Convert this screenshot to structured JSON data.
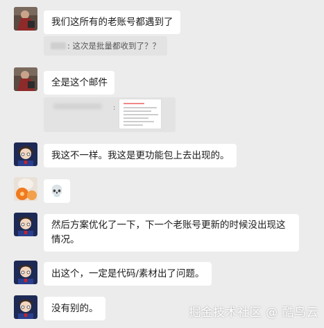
{
  "messages": [
    {
      "avatar": "user-avatar-dark-red",
      "text": "我们这所有的老账号都遇到了"
    },
    {
      "quote": ": 这次是批量都收到了？？"
    },
    {
      "avatar": "user-avatar-dark-red",
      "text": "全是这个邮件"
    },
    {
      "quote_image_sep": ":"
    },
    {
      "avatar": "user-avatar-anime-blue",
      "text": "我这不一样。我这是更功能包上去出现的。"
    },
    {
      "avatar": "user-avatar-orange",
      "text": "💀"
    },
    {
      "avatar": "user-avatar-anime-blue",
      "text": "然后方案优化了一下，下一个老账号更新的时候没出现这情况。"
    },
    {
      "avatar": "user-avatar-anime-blue",
      "text": "出这个，一定是代码/素材出了问题。"
    },
    {
      "avatar": "user-avatar-anime-blue",
      "text": "没有别的。"
    }
  ],
  "watermark": "掘金技术社区 @ 酷鸟云",
  "colors": {
    "background": "#ececec",
    "bubble": "#ffffff",
    "quote": "#e3e3e3"
  }
}
